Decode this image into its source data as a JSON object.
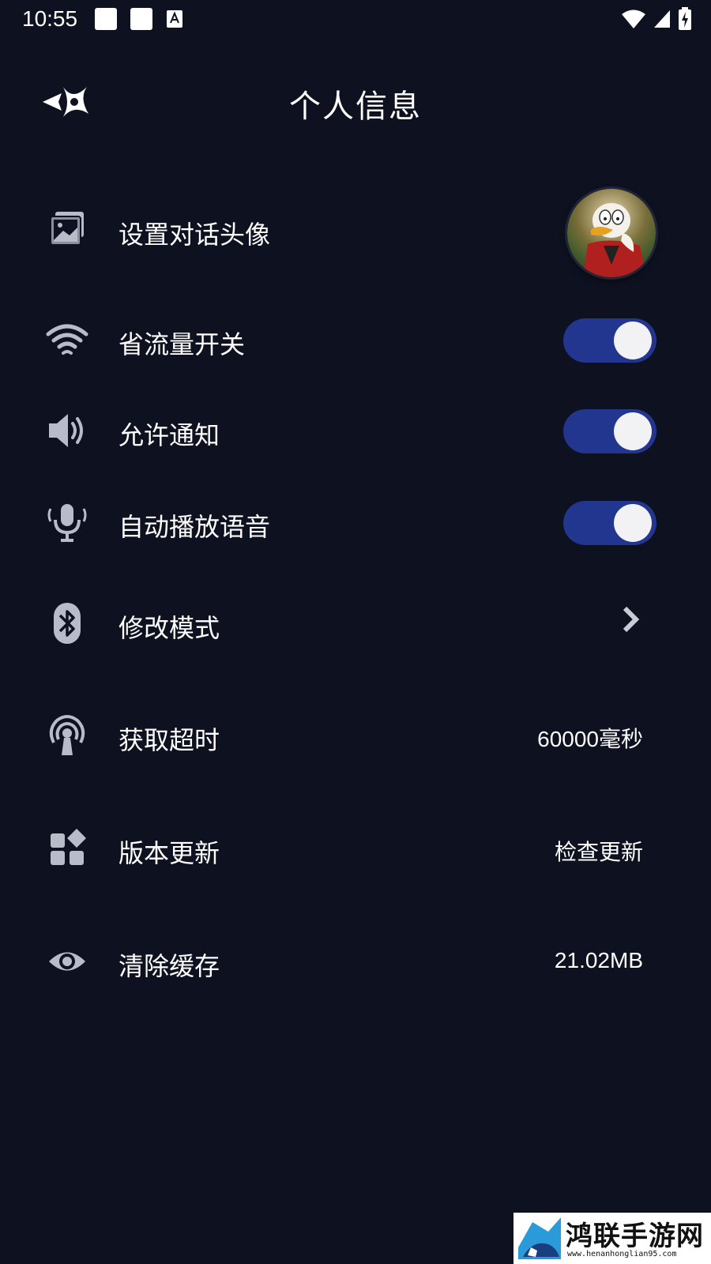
{
  "status_bar": {
    "time": "10:55"
  },
  "header": {
    "title": "个人信息"
  },
  "settings": {
    "avatar_label": "设置对话头像",
    "data_saver_label": "省流量开关",
    "notifications_label": "允许通知",
    "autoplay_voice_label": "自动播放语音",
    "mode_label": "修改模式",
    "timeout_label": "获取超时",
    "timeout_value": "60000毫秒",
    "update_label": "版本更新",
    "update_value": "检查更新",
    "cache_label": "清除缓存",
    "cache_value": "21.02MB",
    "toggles": {
      "data_saver": true,
      "notifications": true,
      "autoplay_voice": true
    }
  },
  "watermark": {
    "text": "鸿联手游网",
    "url": "www.henanhonglian95.com"
  },
  "colors": {
    "background": "#0e1120",
    "toggle_on": "#22368f",
    "icon_gray": "#b8bcc8"
  },
  "icons": [
    "back-icon",
    "image-icon",
    "wifi-icon",
    "speaker-icon",
    "microphone-icon",
    "bluetooth-icon",
    "antenna-icon",
    "apps-icon",
    "eye-icon",
    "chevron-right-icon"
  ]
}
